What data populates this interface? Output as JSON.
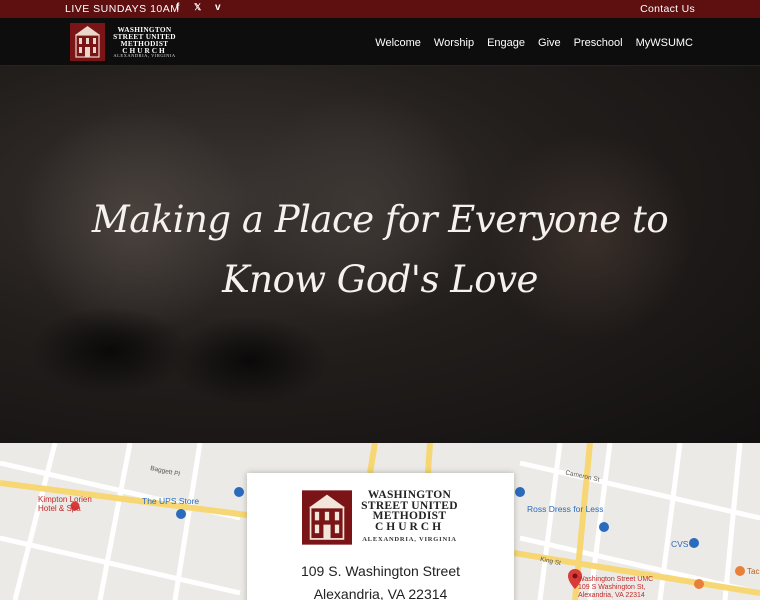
{
  "topbar": {
    "live_text": "LIVE SUNDAYS 10AM",
    "social": [
      {
        "icon": "facebook-icon",
        "glyph": "f"
      },
      {
        "icon": "x-twitter-icon",
        "glyph": "𝕏"
      },
      {
        "icon": "vimeo-icon",
        "glyph": "v"
      }
    ],
    "contact_label": "Contact Us"
  },
  "header": {
    "logo": {
      "line1": "WASHINGTON",
      "line2": "STREET UNITED",
      "line3": "METHODIST",
      "line4": "CHURCH",
      "city": "ALEXANDRIA, VIRGINIA"
    },
    "nav": [
      "Welcome",
      "Worship",
      "Engage",
      "Give",
      "Preschool",
      "MyWSUMC"
    ]
  },
  "hero": {
    "line1": "Making a Place for Everyone to",
    "line2": "Know God's Love"
  },
  "map": {
    "card": {
      "line1": "WASHINGTON",
      "line2": "STREET UNITED",
      "line3": "METHODIST",
      "line4": "CHURCH",
      "city": "ALEXANDRIA, VIRGINIA",
      "address1": "109 S. Washington Street",
      "address2": "Alexandria, VA 22314"
    },
    "labels": {
      "kimpton1": "Kimpton Lorien",
      "kimpton2": "Hotel & Spa",
      "ups": "The UPS Store",
      "baggett": "Baggett Pl",
      "ross": "Ross Dress for Less",
      "cameron": "Cameron St",
      "king": "King St",
      "cvs": "CVS",
      "church1": "Washington Street UMC",
      "church2": "109 S Washington St,",
      "church3": "Alexandria, VA 22314",
      "taco": "Tac"
    },
    "colors": {
      "road_major": "#f7d774",
      "road_minor": "#ffffff",
      "background": "#eceae6",
      "poi_blue": "#2a6bbd",
      "poi_red": "#d93b3b"
    }
  },
  "colors": {
    "brand_maroon": "#5e0f10",
    "header_bg": "#0e0e0e"
  }
}
